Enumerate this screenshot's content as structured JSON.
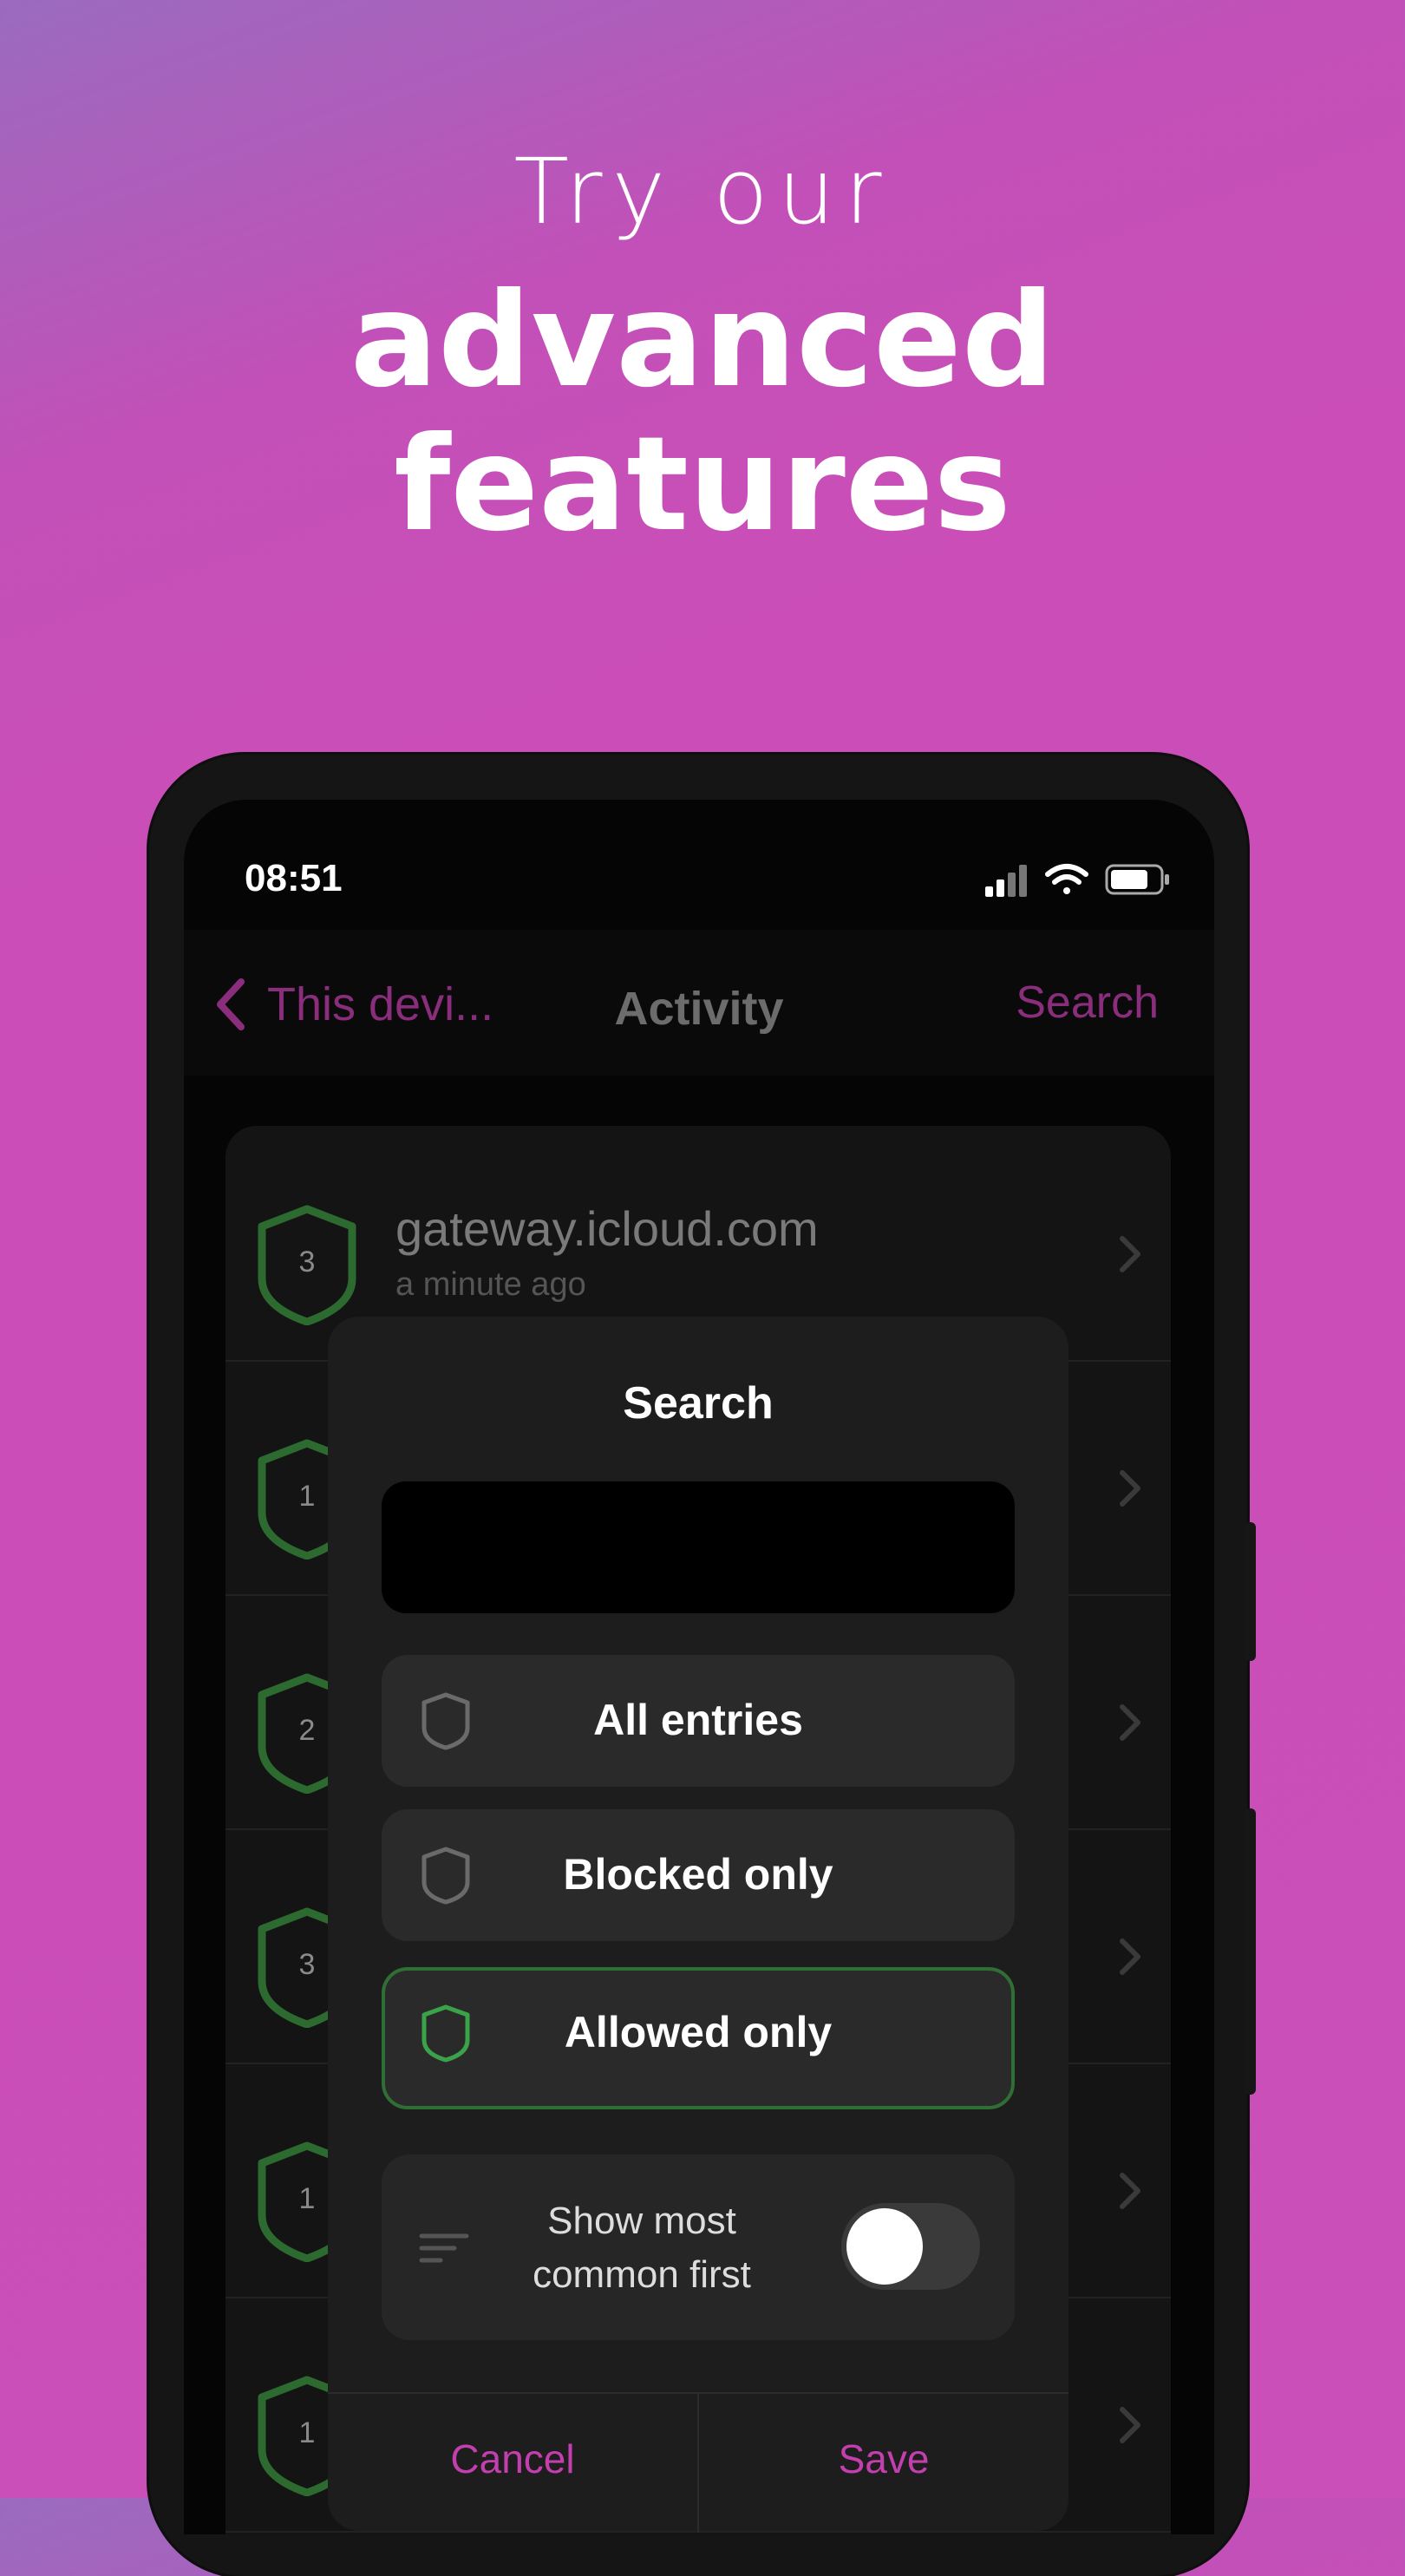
{
  "headline": {
    "line1": "Try our",
    "line2": "advanced",
    "line3": "features"
  },
  "status_bar": {
    "time": "08:51",
    "icons": [
      "signal-icon",
      "wifi-icon",
      "battery-icon"
    ]
  },
  "navbar": {
    "back_label": "This devi...",
    "title": "Activity",
    "search_label": "Search"
  },
  "activity_list": [
    {
      "count": "3",
      "domain": "gateway.icloud.com",
      "time": "a minute ago"
    },
    {
      "count": "1",
      "domain": "",
      "time": ""
    },
    {
      "count": "2",
      "domain": "",
      "time": ""
    },
    {
      "count": "3",
      "domain": "",
      "time": ""
    },
    {
      "count": "1",
      "domain": "",
      "time": ""
    },
    {
      "count": "1",
      "domain": "",
      "time": ""
    }
  ],
  "search_modal": {
    "title": "Search",
    "query": "",
    "filters": [
      {
        "label": "All entries",
        "selected": false
      },
      {
        "label": "Blocked only",
        "selected": false
      },
      {
        "label": "Allowed only",
        "selected": true
      }
    ],
    "toggle_label_line1": "Show most",
    "toggle_label_line2": "common first",
    "toggle_on": false,
    "cancel_label": "Cancel",
    "save_label": "Save"
  },
  "colors": {
    "accent": "#c43fae",
    "accent_dim": "#8a2d7c",
    "allowed_green": "#2f6e34",
    "background_gradient": [
      "#9a6bbf",
      "#cb4fb9"
    ]
  }
}
